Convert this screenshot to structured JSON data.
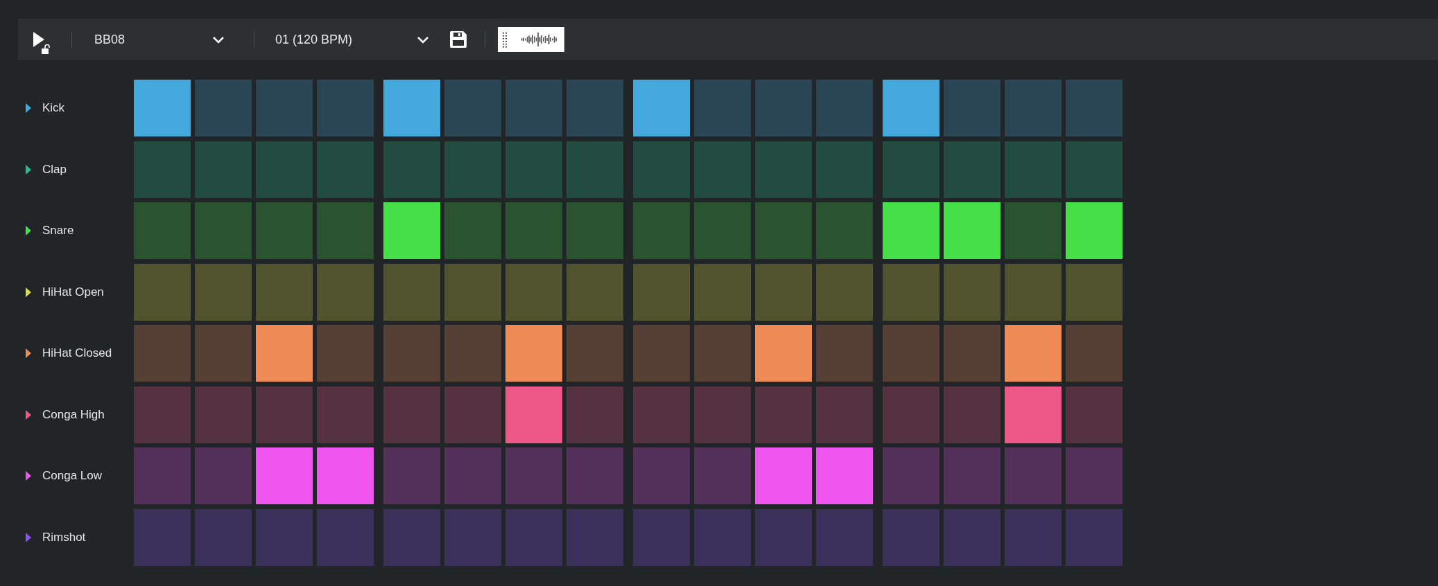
{
  "toolbar": {
    "playing": false,
    "locked": false,
    "kit": {
      "value": "BB08"
    },
    "pattern": {
      "value": "01 (120 BPM)"
    }
  },
  "tracks": [
    {
      "name": "Kick",
      "color": "#45a8dd",
      "steps": [
        true,
        false,
        false,
        false,
        true,
        false,
        false,
        false,
        true,
        false,
        false,
        false,
        true,
        false,
        false,
        false
      ]
    },
    {
      "name": "Clap",
      "color": "#27c08d",
      "steps": [
        false,
        false,
        false,
        false,
        false,
        false,
        false,
        false,
        false,
        false,
        false,
        false,
        false,
        false,
        false,
        false
      ]
    },
    {
      "name": "Snare",
      "color": "#45e048",
      "steps": [
        false,
        false,
        false,
        false,
        true,
        false,
        false,
        false,
        false,
        false,
        false,
        false,
        true,
        true,
        false,
        true
      ]
    },
    {
      "name": "HiHat Open",
      "color": "#e0e040",
      "steps": [
        false,
        false,
        false,
        false,
        false,
        false,
        false,
        false,
        false,
        false,
        false,
        false,
        false,
        false,
        false,
        false
      ]
    },
    {
      "name": "HiHat Closed",
      "color": "#ef8b57",
      "steps": [
        false,
        false,
        true,
        false,
        false,
        false,
        true,
        false,
        false,
        false,
        true,
        false,
        false,
        false,
        true,
        false
      ]
    },
    {
      "name": "Conga High",
      "color": "#ee5889",
      "steps": [
        false,
        false,
        false,
        false,
        false,
        false,
        true,
        false,
        false,
        false,
        false,
        false,
        false,
        false,
        true,
        false
      ]
    },
    {
      "name": "Conga Low",
      "color": "#ee55ee",
      "steps": [
        false,
        false,
        true,
        true,
        false,
        false,
        false,
        false,
        false,
        false,
        true,
        true,
        false,
        false,
        false,
        false
      ]
    },
    {
      "name": "Rimshot",
      "color": "#8a55ee",
      "steps": [
        false,
        false,
        false,
        false,
        false,
        false,
        false,
        false,
        false,
        false,
        false,
        false,
        false,
        false,
        false,
        false
      ]
    }
  ]
}
